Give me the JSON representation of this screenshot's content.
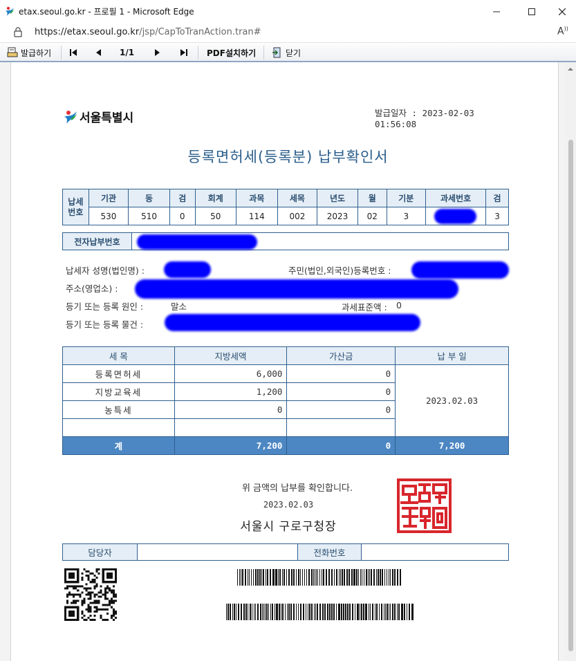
{
  "window": {
    "title": "etax.seoul.go.kr - 프로필 1 - Microsoft Edge",
    "url_host": "https://etax.seoul.go.kr",
    "url_path": "/jsp/CapToTranAction.tran#"
  },
  "toolbar": {
    "print_label": "발급하기",
    "page_indicator": "1/1",
    "pdf_label": "PDF설치하기",
    "close_label": "닫기"
  },
  "document": {
    "org_name": "서울특별시",
    "issue_label": "발급일자 : 2023-02-03",
    "issue_time": "01:56:08",
    "title": "등록면허세(등록분) 납부확인서",
    "tax_number": {
      "row_label_1": "납세",
      "row_label_2": "번호",
      "headers": [
        "기관",
        "동",
        "검",
        "회계",
        "과목",
        "세목",
        "년도",
        "월",
        "기분",
        "과세번호",
        "검"
      ],
      "values": [
        "530",
        "510",
        "0",
        "50",
        "114",
        "002",
        "2023",
        "02",
        "3",
        "",
        "3"
      ]
    },
    "epay_label": "전자납부번호",
    "taxpayer_label": "납세자 성명(법인명) :",
    "resident_no_label": "주민(법인,외국인)등록번호 :",
    "address_label": "주소(영업소) :",
    "cause_label": "등기 또는 등록 원인 :",
    "cause_value": "말소",
    "tax_base_label": "과세표준액 :",
    "tax_base_value": "0",
    "object_label": "등기 또는 등록 물건 :",
    "amounts": {
      "headers": [
        "세 목",
        "지방세액",
        "가산금",
        "납 부 일"
      ],
      "rows": [
        {
          "name": "등록면허세",
          "tax": "6,000",
          "surcharge": "0"
        },
        {
          "name": "지방교육세",
          "tax": "1,200",
          "surcharge": "0"
        },
        {
          "name": "농특세",
          "tax": "0",
          "surcharge": "0"
        }
      ],
      "payment_date": "2023.02.03",
      "total_label": "계",
      "total_tax": "7,200",
      "total_surcharge": "0",
      "total_paid": "7,200"
    },
    "confirm_text": "위 금액의 납부를 확인합니다.",
    "confirm_date": "2023.02.03",
    "signer": "서울시 구로구청장",
    "staff_label": "담당자",
    "phone_label": "전화번호"
  },
  "colors": {
    "title_blue": "#2a5d8a",
    "table_border": "#2f5f8f",
    "total_row": "#4c87c3",
    "redaction": "#0000ff",
    "seal_red": "#d8262c"
  }
}
